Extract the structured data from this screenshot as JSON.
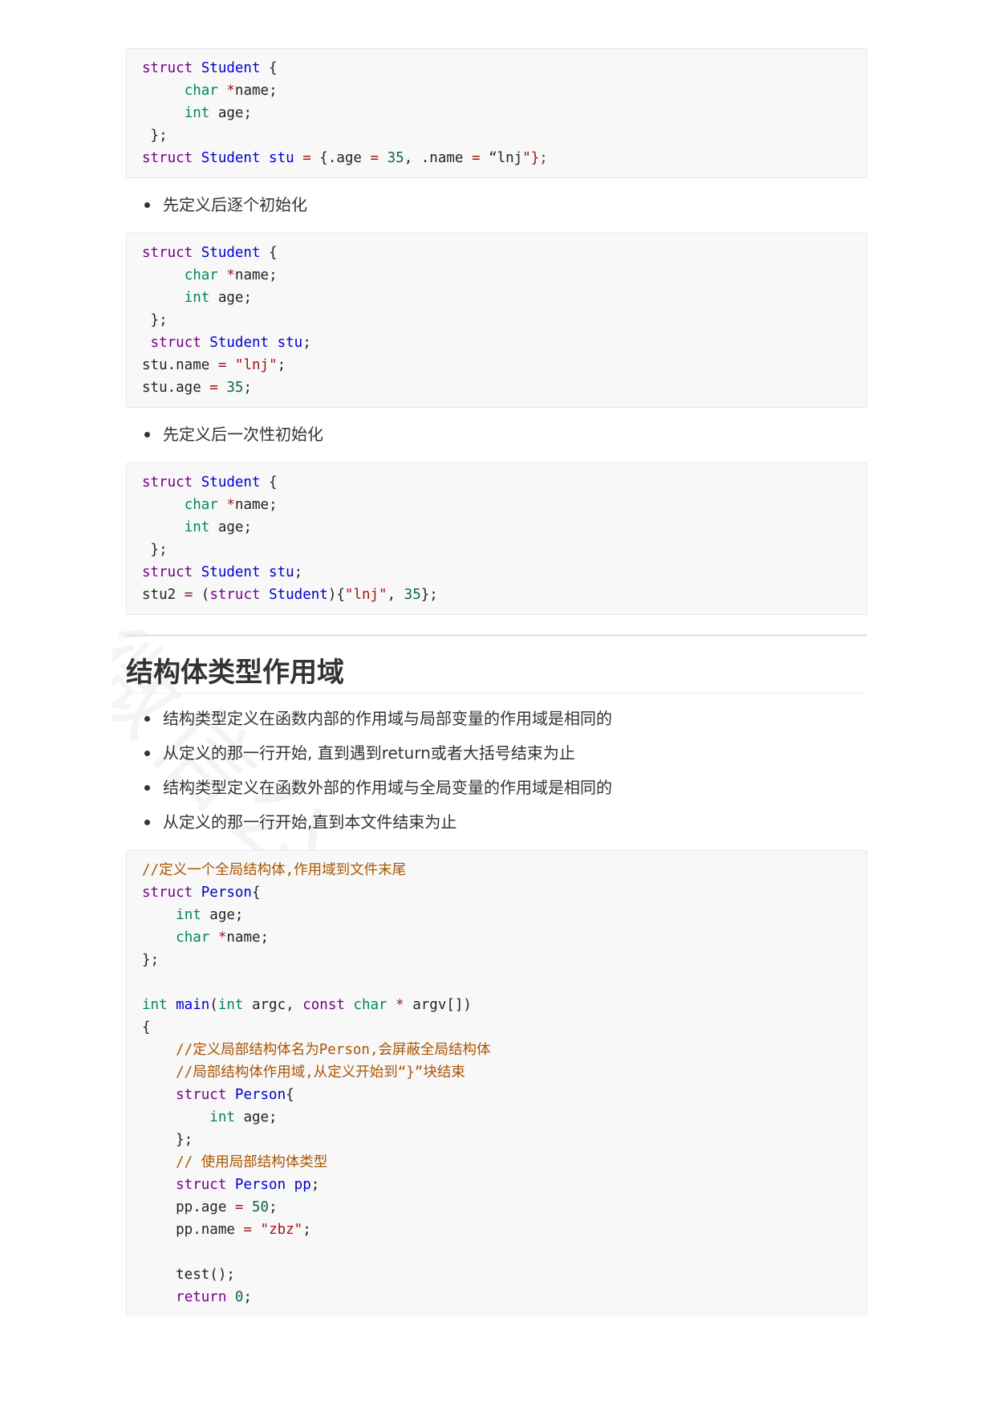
{
  "code_block_1": [
    [
      [
        "kw",
        "struct"
      ],
      [
        "",
        ""
      ],
      [
        "df",
        " Student"
      ],
      [
        "",
        " {"
      ]
    ],
    [
      [
        "",
        "     "
      ],
      [
        "ty",
        "char"
      ],
      [
        "op",
        " *"
      ],
      [
        "",
        "name;"
      ]
    ],
    [
      [
        "",
        "     "
      ],
      [
        "ty",
        "int"
      ],
      [
        "",
        " age;"
      ]
    ],
    [
      [
        "",
        " };"
      ]
    ],
    [
      [
        "kw",
        "struct"
      ],
      [
        "df",
        " Student"
      ],
      [
        "df",
        " stu"
      ],
      [
        "op",
        " ="
      ],
      [
        "",
        " {.age "
      ],
      [
        "op",
        "="
      ],
      [
        "",
        " "
      ],
      [
        "num",
        "35"
      ],
      [
        "",
        ", .name "
      ],
      [
        "op",
        "="
      ],
      [
        "",
        " “lnj"
      ],
      [
        "str",
        "\"};"
      ]
    ]
  ],
  "bullet_1": "先定义后逐个初始化",
  "code_block_2": [
    [
      [
        "kw",
        "struct"
      ],
      [
        "df",
        " Student"
      ],
      [
        "",
        " {"
      ]
    ],
    [
      [
        "",
        "     "
      ],
      [
        "ty",
        "char"
      ],
      [
        "op",
        " *"
      ],
      [
        "",
        "name;"
      ]
    ],
    [
      [
        "",
        "     "
      ],
      [
        "ty",
        "int"
      ],
      [
        "",
        " age;"
      ]
    ],
    [
      [
        "",
        " };"
      ]
    ],
    [
      [
        "",
        " "
      ],
      [
        "kw",
        "struct"
      ],
      [
        "df",
        " Student"
      ],
      [
        "df",
        " stu"
      ],
      [
        "",
        ";"
      ]
    ],
    [
      [
        "",
        "stu.name "
      ],
      [
        "op",
        "="
      ],
      [
        "",
        " "
      ],
      [
        "str",
        "\"lnj\""
      ],
      [
        "",
        ";"
      ]
    ],
    [
      [
        "",
        "stu.age "
      ],
      [
        "op",
        "="
      ],
      [
        "",
        " "
      ],
      [
        "num",
        "35"
      ],
      [
        "",
        ";"
      ]
    ]
  ],
  "bullet_2": "先定义后一次性初始化",
  "code_block_3": [
    [
      [
        "kw",
        "struct"
      ],
      [
        "df",
        " Student"
      ],
      [
        "",
        " {"
      ]
    ],
    [
      [
        "",
        "     "
      ],
      [
        "ty",
        "char"
      ],
      [
        "op",
        " *"
      ],
      [
        "",
        "name;"
      ]
    ],
    [
      [
        "",
        "     "
      ],
      [
        "ty",
        "int"
      ],
      [
        "",
        " age;"
      ]
    ],
    [
      [
        "",
        " };"
      ]
    ],
    [
      [
        "kw",
        "struct"
      ],
      [
        "df",
        " Student"
      ],
      [
        "df",
        " stu"
      ],
      [
        "",
        ";"
      ]
    ],
    [
      [
        "",
        "stu2 "
      ],
      [
        "op",
        "="
      ],
      [
        "",
        " ("
      ],
      [
        "kw",
        "struct"
      ],
      [
        "df",
        " Student"
      ],
      [
        "",
        "){"
      ],
      [
        "str",
        "\"lnj\""
      ],
      [
        "",
        ", "
      ],
      [
        "num",
        "35"
      ],
      [
        "",
        "};"
      ]
    ]
  ],
  "heading": "结构体类型作用域",
  "bullets_scope": [
    "结构类型定义在函数内部的作用域与局部变量的作用域是相同的",
    "从定义的那一行开始, 直到遇到return或者大括号结束为止",
    "结构类型定义在函数外部的作用域与全局变量的作用域是相同的",
    "从定义的那一行开始,直到本文件结束为止"
  ],
  "code_block_4": [
    [
      [
        "cm",
        "//定义一个全局结构体,作用域到文件末尾"
      ]
    ],
    [
      [
        "kw",
        "struct"
      ],
      [
        "df",
        " Person"
      ],
      [
        "",
        "{"
      ]
    ],
    [
      [
        "",
        "    "
      ],
      [
        "ty",
        "int"
      ],
      [
        "",
        " age;"
      ]
    ],
    [
      [
        "",
        "    "
      ],
      [
        "ty",
        "char"
      ],
      [
        "op",
        " *"
      ],
      [
        "",
        "name;"
      ]
    ],
    [
      [
        "",
        "};"
      ]
    ],
    [
      [
        "",
        ""
      ]
    ],
    [
      [
        "ty",
        "int"
      ],
      [
        "df",
        " main"
      ],
      [
        "",
        "("
      ],
      [
        "ty",
        "int"
      ],
      [
        "",
        " argc, "
      ],
      [
        "kw",
        "const"
      ],
      [
        "ty",
        " char"
      ],
      [
        "op",
        " *"
      ],
      [
        "",
        " argv[])"
      ]
    ],
    [
      [
        "",
        "{"
      ]
    ],
    [
      [
        "",
        "    "
      ],
      [
        "cm",
        "//定义局部结构体名为Person,会屏蔽全局结构体"
      ]
    ],
    [
      [
        "",
        "    "
      ],
      [
        "cm",
        "//局部结构体作用域,从定义开始到“}”块结束"
      ]
    ],
    [
      [
        "",
        "    "
      ],
      [
        "kw",
        "struct"
      ],
      [
        "df",
        " Person"
      ],
      [
        "",
        "{"
      ]
    ],
    [
      [
        "",
        "        "
      ],
      [
        "ty",
        "int"
      ],
      [
        "",
        " age;"
      ]
    ],
    [
      [
        "",
        "    };"
      ]
    ],
    [
      [
        "",
        "    "
      ],
      [
        "cm",
        "// 使用局部结构体类型"
      ]
    ],
    [
      [
        "",
        "    "
      ],
      [
        "kw",
        "struct"
      ],
      [
        "df",
        " Person"
      ],
      [
        "df",
        " pp"
      ],
      [
        "",
        ";"
      ]
    ],
    [
      [
        "",
        "    pp.age "
      ],
      [
        "op",
        "="
      ],
      [
        "",
        " "
      ],
      [
        "num",
        "50"
      ],
      [
        "",
        ";"
      ]
    ],
    [
      [
        "",
        "    pp.name "
      ],
      [
        "op",
        "="
      ],
      [
        "",
        " "
      ],
      [
        "str",
        "\"zbz\""
      ],
      [
        "",
        ";"
      ]
    ],
    [
      [
        "",
        ""
      ]
    ],
    [
      [
        "",
        "    test();"
      ]
    ],
    [
      [
        "",
        "    "
      ],
      [
        "kw",
        "return"
      ],
      [
        "",
        " "
      ],
      [
        "num",
        "0"
      ],
      [
        "",
        ";"
      ]
    ]
  ],
  "watermark": "微信公众号代码情缘"
}
